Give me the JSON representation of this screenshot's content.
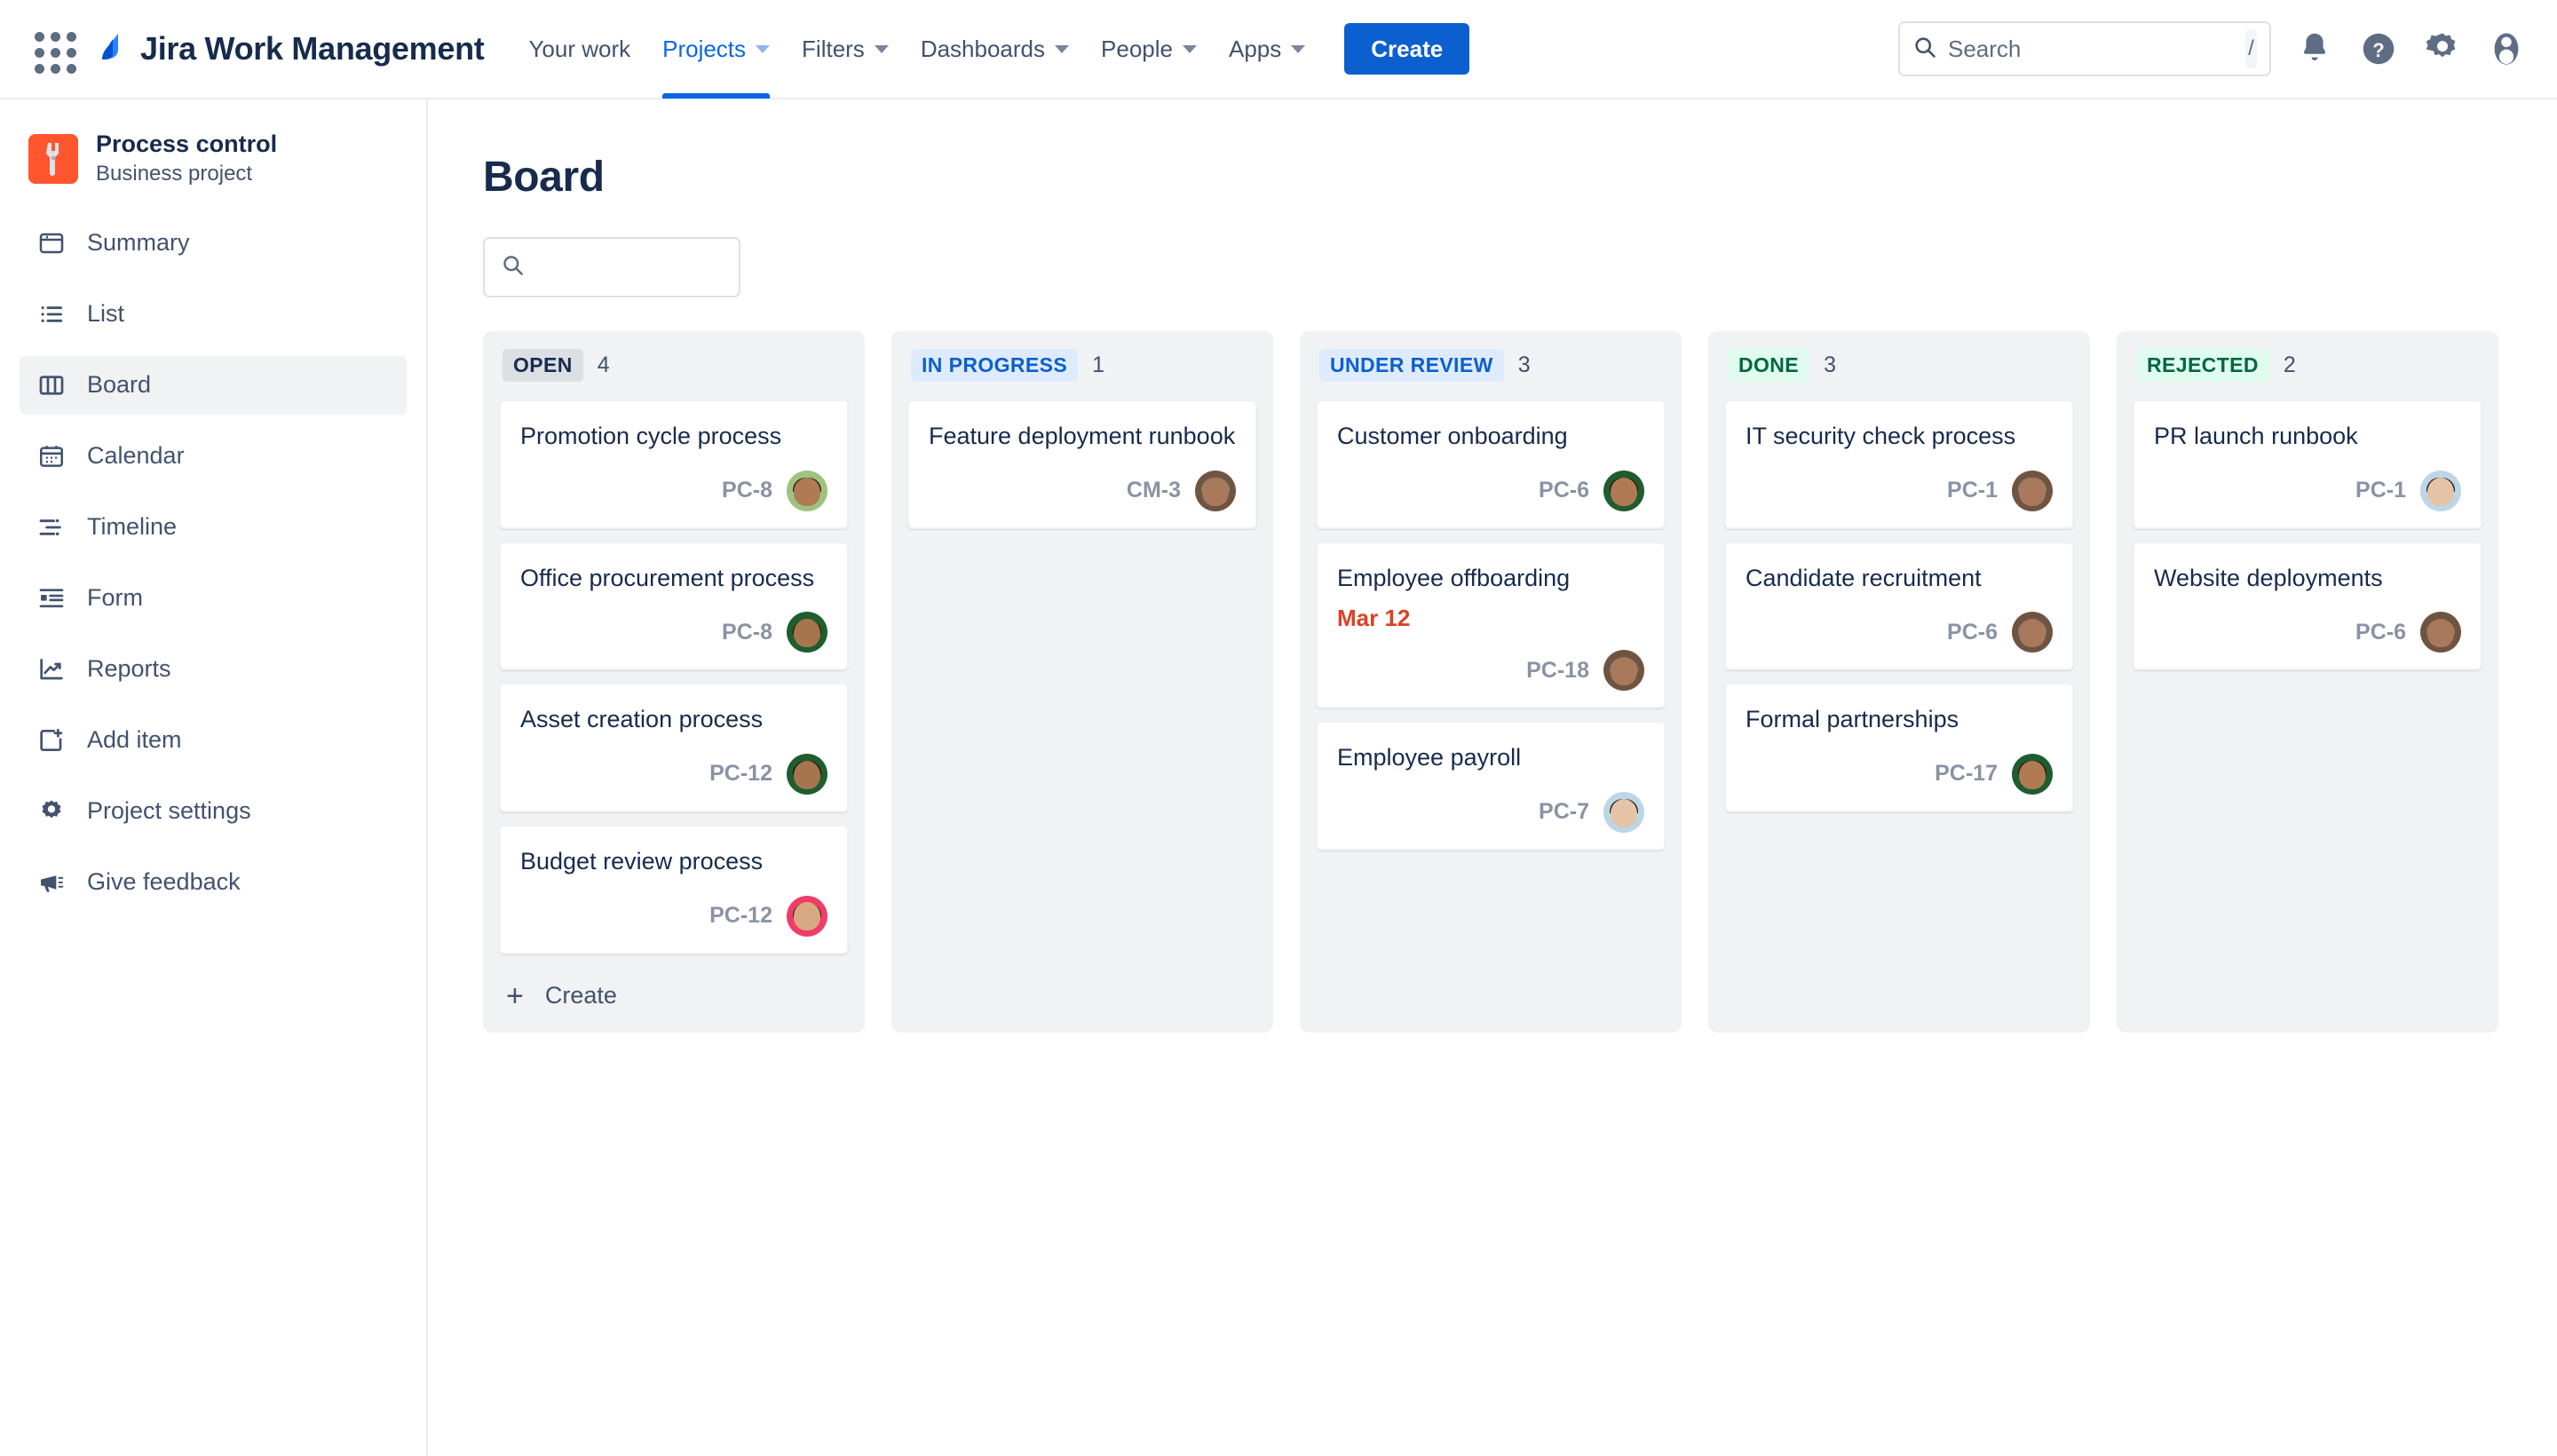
{
  "topnav": {
    "app_switcher_icon": "grid-apps-icon",
    "logo_icon": "jira-logo-icon",
    "product_name": "Jira Work Management",
    "items": [
      {
        "label": "Your work",
        "has_caret": false,
        "active": false
      },
      {
        "label": "Projects",
        "has_caret": true,
        "active": true
      },
      {
        "label": "Filters",
        "has_caret": true,
        "active": false
      },
      {
        "label": "Dashboards",
        "has_caret": true,
        "active": false
      },
      {
        "label": "People",
        "has_caret": true,
        "active": false
      },
      {
        "label": "Apps",
        "has_caret": true,
        "active": false
      }
    ],
    "create_label": "Create",
    "search": {
      "placeholder": "Search",
      "value": "",
      "shortcut": "/",
      "icon": "search-icon"
    },
    "icons": [
      {
        "name": "notifications-bell-icon"
      },
      {
        "name": "help-question-icon"
      },
      {
        "name": "settings-gear-icon"
      },
      {
        "name": "user-profile-avatar-icon"
      }
    ],
    "accent_color": "#0c66e4",
    "create_button_color": "#0c5fce"
  },
  "sidebar": {
    "project": {
      "name": "Process control",
      "type": "Business project",
      "avatar_icon": "wrench-icon",
      "avatar_color": "#ff5630"
    },
    "items": [
      {
        "label": "Summary",
        "icon": "summary-window-icon",
        "selected": false
      },
      {
        "label": "List",
        "icon": "list-icon",
        "selected": false
      },
      {
        "label": "Board",
        "icon": "board-columns-icon",
        "selected": true
      },
      {
        "label": "Calendar",
        "icon": "calendar-icon",
        "selected": false
      },
      {
        "label": "Timeline",
        "icon": "timeline-icon",
        "selected": false
      },
      {
        "label": "Form",
        "icon": "form-icon",
        "selected": false
      },
      {
        "label": "Reports",
        "icon": "reports-chart-icon",
        "selected": false
      },
      {
        "label": "Add item",
        "icon": "add-item-plus-icon",
        "selected": false
      },
      {
        "label": "Project settings",
        "icon": "gear-icon",
        "selected": false
      },
      {
        "label": "Give feedback",
        "icon": "megaphone-icon",
        "selected": false
      }
    ]
  },
  "main": {
    "title": "Board",
    "board_search": {
      "placeholder": "",
      "value": "",
      "icon": "search-icon"
    },
    "columns": [
      {
        "name": "OPEN",
        "count": "4",
        "badge_style": "gray",
        "show_create": true,
        "create_label": "Create",
        "cards": [
          {
            "title": "Promotion cycle process",
            "key": "PC-8",
            "due": "",
            "avatar": {
              "skin": "#b07a54",
              "hair": "#1d1208",
              "bg": "#9ec27f"
            }
          },
          {
            "title": "Office procurement process",
            "key": "PC-8",
            "due": "",
            "avatar": {
              "skin": "#a6744d",
              "hair": "#16100a",
              "bg": "#1f5c2e"
            }
          },
          {
            "title": "Asset creation process",
            "key": "PC-12",
            "due": "",
            "avatar": {
              "skin": "#a6744d",
              "hair": "#16100a",
              "bg": "#1f5c2e"
            }
          },
          {
            "title": "Budget review process",
            "key": "PC-12",
            "due": "",
            "avatar": {
              "skin": "#d8a882",
              "hair": "#2a1a12",
              "bg": "#ef3d6b"
            }
          }
        ]
      },
      {
        "name": "IN PROGRESS",
        "count": "1",
        "badge_style": "blue",
        "show_create": false,
        "create_label": "Create",
        "cards": [
          {
            "title": "Feature deployment runbook",
            "key": "CM-3",
            "due": "",
            "avatar": {
              "skin": "#a8795a",
              "hair": "#8d8377",
              "bg": "#6f5442"
            }
          }
        ]
      },
      {
        "name": "UNDER REVIEW",
        "count": "3",
        "badge_style": "blue",
        "show_create": false,
        "create_label": "Create",
        "cards": [
          {
            "title": "Customer onboarding",
            "key": "PC-6",
            "due": "",
            "avatar": {
              "skin": "#b07a54",
              "hair": "#221508",
              "bg": "#1f5c2e"
            }
          },
          {
            "title": "Employee offboarding",
            "key": "PC-18",
            "due": "Mar 12",
            "avatar": {
              "skin": "#a8795a",
              "hair": "#8d8377",
              "bg": "#6f5442"
            }
          },
          {
            "title": "Employee payroll",
            "key": "PC-7",
            "due": "",
            "avatar": {
              "skin": "#e5c3a6",
              "hair": "#150f0c",
              "bg": "#bcd6e6"
            }
          }
        ]
      },
      {
        "name": "DONE",
        "count": "3",
        "badge_style": "green",
        "show_create": false,
        "create_label": "Create",
        "cards": [
          {
            "title": "IT security check process",
            "key": "PC-1",
            "due": "",
            "avatar": {
              "skin": "#a8795a",
              "hair": "#8d8377",
              "bg": "#6f5442"
            }
          },
          {
            "title": "Candidate recruitment",
            "key": "PC-6",
            "due": "",
            "avatar": {
              "skin": "#a8795a",
              "hair": "#8d8377",
              "bg": "#6f5442"
            }
          },
          {
            "title": "Formal partnerships",
            "key": "PC-17",
            "due": "",
            "avatar": {
              "skin": "#b07a54",
              "hair": "#221508",
              "bg": "#1f5c2e"
            }
          }
        ]
      },
      {
        "name": "REJECTED",
        "count": "2",
        "badge_style": "green",
        "show_create": false,
        "create_label": "Create",
        "cards": [
          {
            "title": "PR launch runbook",
            "key": "PC-1",
            "due": "",
            "avatar": {
              "skin": "#e5c3a6",
              "hair": "#150f0c",
              "bg": "#bcd6e6"
            }
          },
          {
            "title": "Website deployments",
            "key": "PC-6",
            "due": "",
            "avatar": {
              "skin": "#a8795a",
              "hair": "#8d8377",
              "bg": "#6f5442"
            }
          }
        ]
      }
    ]
  },
  "colors": {
    "due_date_overdue": "#d94224",
    "column_background": "#f1f2f4",
    "text_primary": "#172b4d",
    "text_secondary": "#42526e"
  }
}
